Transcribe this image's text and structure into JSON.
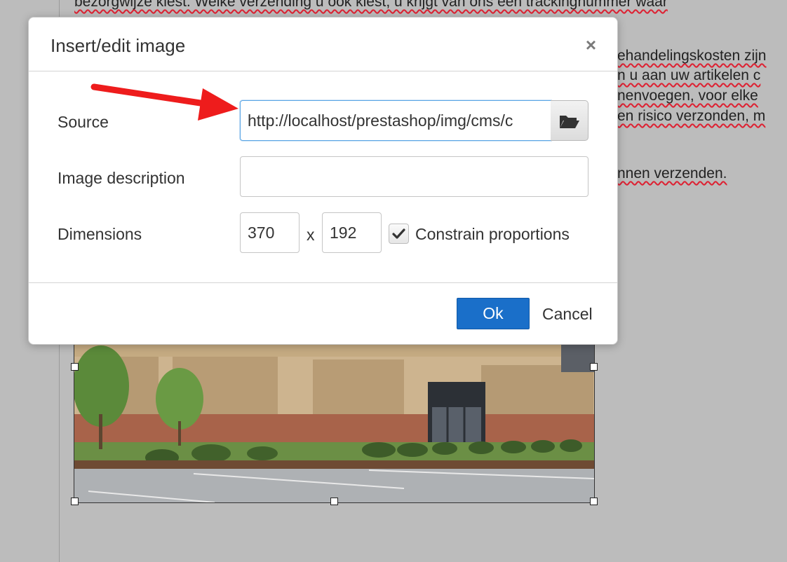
{
  "background": {
    "lines": [
      "bezorgwijze kiest. Welke verzending u ook kiest, u krijgt van ons een trackingnummer waar",
      "ehandelingskosten zijn",
      "n u aan uw artikelen c",
      "nenvoegen, voor elke",
      "en risico verzonden, m",
      "nnen verzenden."
    ]
  },
  "dialog": {
    "title": "Insert/edit image",
    "close_glyph": "×",
    "source_label": "Source",
    "source_value": "http://localhost/prestashop/img/cms/c",
    "description_label": "Image description",
    "description_value": "",
    "dimensions_label": "Dimensions",
    "width_value": "370",
    "height_value": "192",
    "separator": "x",
    "constrain_label": "Constrain proportions",
    "constrain_checked": true,
    "ok_label": "Ok",
    "cancel_label": "Cancel"
  },
  "icons": {
    "browse": "folder-open-icon",
    "close": "close-icon",
    "check": "checkmark-icon",
    "annotation": "red-arrow-icon"
  },
  "colors": {
    "accent": "#1a6fc9",
    "focus_border": "#59a5e5",
    "annotation_arrow": "#ee1c1c",
    "overlay": "#bcbcbc"
  }
}
